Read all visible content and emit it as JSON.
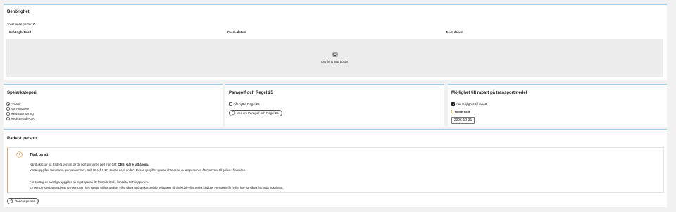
{
  "behorighet": {
    "title": "Behörighet",
    "total_label": "Totalt antal poster:",
    "total_value": "0",
    "columns": [
      "Behörighetsroll",
      "Fr.om. datum",
      "T.o.m datum"
    ],
    "empty_icon": "inbox-icon",
    "empty_text": "Det finns inga poster"
  },
  "spelarkategori": {
    "title": "Spelarkategori",
    "options": [
      {
        "label": "Amatör",
        "selected": true
      },
      {
        "label": "Non-amateur",
        "selected": false
      },
      {
        "label": "Reamatörisering",
        "selected": false
      },
      {
        "label": "Registrerad PGA",
        "selected": false
      }
    ]
  },
  "paragolf": {
    "title": "Paragolf och Regel 25",
    "checkbox_label": "Får nyttja Regel 25",
    "checkbox_checked": false,
    "link_icon": "external-link-icon",
    "link_label": "Mer om Paragolf och Regel 25"
  },
  "rabatt": {
    "title": "Möjlighet till rabatt på transportmedel",
    "checkbox_label": "Har möjlighet till rabatt",
    "checkbox_checked": true,
    "date_label": "Giltigt t.o.m",
    "date_value": "2026-12-31"
  },
  "radera": {
    "title": "Radera person",
    "alert_icon": "warning-icon",
    "alert_title": "Tänk på att",
    "p1_a": "När du klickar på Radera person tar du bort personen helt från GIT.",
    "p1_b": "OBS: Går ej att ångra.",
    "p2": "Vissa uppgifter som namn, personnummer, Golf-ID och HCP sparas dock undan. Dessa uppgifter sparas i händelse av att personen återkommer till golfen i framtiden.",
    "p3": "För borttag av samtliga uppgifter så inget sparas för framtida bruk, kontakta GIT-supporten.",
    "p4": "En person kan bara raderas när personen helt saknar giltiga avgifter eller några andra ekonomiska relationer till din klubb eller andra klubbar. Personen får hellre inte ha några framtida bokningar.",
    "button_icon": "trash-icon",
    "button_label": "Radera person"
  },
  "colors": {
    "accent_border": "#a8cde6",
    "warning": "#e8a56c",
    "empty_bg": "#ececec"
  }
}
